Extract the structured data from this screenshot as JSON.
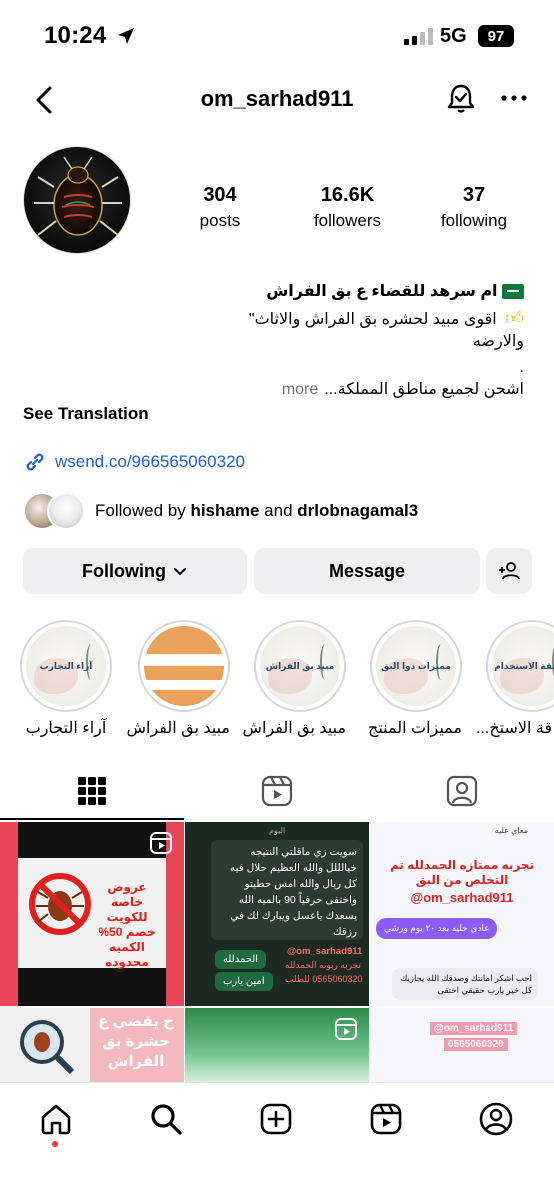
{
  "status_bar": {
    "time": "10:24",
    "network": "5G",
    "battery": "97"
  },
  "header": {
    "username": "om_sarhad911"
  },
  "stats": [
    {
      "value": "304",
      "label": "posts"
    },
    {
      "value": "16.6K",
      "label": "followers"
    },
    {
      "value": "37",
      "label": "following"
    }
  ],
  "bio": {
    "name": "ام سرهد للقضاء ع بق الفراش",
    "line1": "اقوى مبيد لحشره بق الفراش والاثاث\"",
    "line2": "والارضه",
    "line3": ".",
    "line4": "اشحن لجميع مناطق المملكة...",
    "more": "more",
    "see_translation": "See Translation",
    "link": "wsend.co/966565060320"
  },
  "followed_by": {
    "prefix": "Followed by",
    "user1": "hishame",
    "and": "and",
    "user2": "drlobnagamal3"
  },
  "buttons": {
    "following": "Following",
    "message": "Message"
  },
  "highlights": [
    {
      "caption": "قة الاستخ...",
      "inner": "طريقة الاستخدام",
      "type": "logo"
    },
    {
      "caption": "مميزات المنتج",
      "inner": "مميزات دوا البق",
      "type": "logo"
    },
    {
      "caption": "مبيد بق الفراش",
      "inner": "مبيد بق الفراش",
      "type": "logo"
    },
    {
      "caption": "مبيد بق الفراش",
      "inner": "",
      "type": "stripes"
    },
    {
      "caption": "آراء التجارب",
      "inner": "آراء التجارب",
      "type": "logo"
    }
  ],
  "posts": {
    "p1": {
      "text": "عروض خاصه للكويت خصم 50% الكميه محدوده"
    },
    "p2": {
      "header": "اليوم",
      "message": "سويت زي ماقلتي النتيجه خيالللل والله العظيم حلال فيه كل ريال والله امس حطيتو واختفى حرفياً 90 بالميه الله يسعدك ياعسل ويبارك لك في رزقك",
      "reply1": "الحمدلله",
      "reply2": "امين يارب",
      "watermark1": "@om_sarhad911",
      "watermark2": "تجربه ربونه الحمدلله",
      "watermark3": "0565060320 للطلب"
    },
    "p3": {
      "top": "معاي عليه",
      "headline": "تجربه ممتازه الحمدلله تم التخلص من البق",
      "handle": "@om_sarhad911",
      "bubble": "عادي خليه بعد ٢٠ يوم ورشي",
      "reply": "احب اشكر امانتك وصدقك الله يجازيك كل خير يارب حقيقي اختفى",
      "watermark1": "@om_sarhad911",
      "watermark2": "0565060320"
    },
    "p4": {
      "text": "ح يقضي ع حشرة بق الفراش"
    }
  },
  "colors": {
    "link": "#1f5fd1",
    "button_bg": "#efeff1",
    "notification_dot": "#ff3040"
  },
  "icons": {
    "header": [
      "back-chevron-icon",
      "bell-check-icon",
      "more-horizontal-icon"
    ],
    "tabs": [
      "grid-icon",
      "reels-icon",
      "tagged-icon"
    ],
    "nav": [
      "home-icon",
      "search-icon",
      "create-icon",
      "reels-icon",
      "profile-icon"
    ]
  }
}
